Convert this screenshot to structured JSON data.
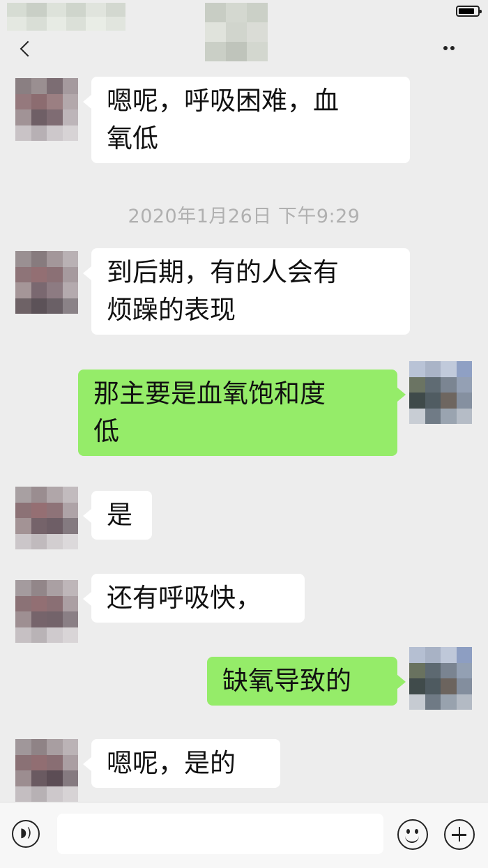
{
  "timestamp": "2020年1月26日 下午9:29",
  "messages": [
    {
      "side": "left",
      "text_line1": "嗯呢，呼吸困难，血",
      "text_line2": "氧低"
    },
    {
      "side": "left",
      "text_line1": "到后期，有的人会有",
      "text_line2": "烦躁的表现"
    },
    {
      "side": "right",
      "text_line1": "那主要是血氧饱和度",
      "text_line2": "低"
    },
    {
      "side": "left",
      "text": "是"
    },
    {
      "side": "left",
      "text": "还有呼吸快，"
    },
    {
      "side": "right",
      "text": "缺氧导致的"
    },
    {
      "side": "left",
      "text": "嗯呢，是的"
    }
  ],
  "input": {
    "placeholder": "",
    "value": ""
  },
  "icons": {
    "back": "back-icon",
    "more": "more-icon",
    "voice": "voice-icon",
    "emoji": "emoji-icon",
    "plus": "plus-icon",
    "battery": "battery-icon"
  },
  "colors": {
    "background": "#ededed",
    "bubble_self": "#95ec69",
    "bubble_other": "#ffffff",
    "timestamp": "#b0b0b0"
  }
}
